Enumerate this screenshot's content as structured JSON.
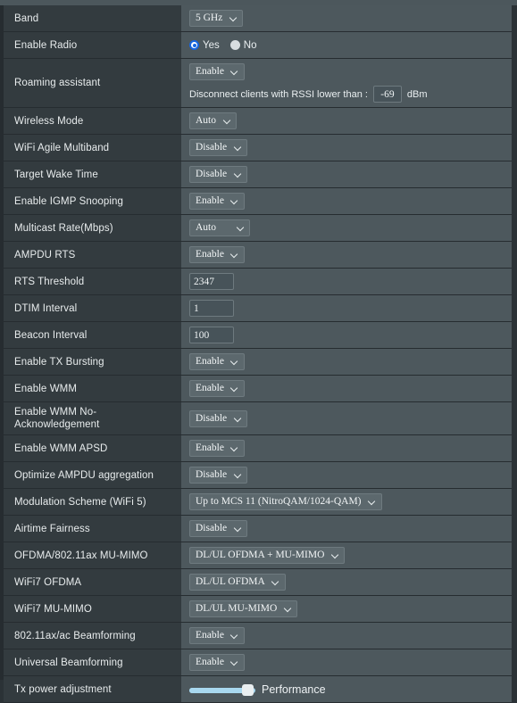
{
  "theme": {
    "panel_bg": "#4d585d",
    "label_bg": "#333b3f",
    "divider": "#262c30",
    "control_bg": "#5c686d",
    "input_bg": "#475359",
    "accent_radio": "#1565e0",
    "slider_track": "#a8d8ef"
  },
  "rows": [
    {
      "label": "Band",
      "control": "select",
      "value": "5 GHz"
    },
    {
      "label": "Enable Radio",
      "control": "radio",
      "options": [
        "Yes",
        "No"
      ],
      "selected": "Yes"
    },
    {
      "label": "Roaming assistant",
      "control": "select-with-note",
      "value": "Enable",
      "note_text": "Disconnect clients with RSSI lower than :",
      "note_value": "-69",
      "note_unit": "dBm"
    },
    {
      "label": "Wireless Mode",
      "control": "select",
      "value": "Auto"
    },
    {
      "label": "WiFi Agile Multiband",
      "control": "select",
      "value": "Disable"
    },
    {
      "label": "Target Wake Time",
      "control": "select",
      "value": "Disable"
    },
    {
      "label": "Enable IGMP Snooping",
      "control": "select",
      "value": "Enable"
    },
    {
      "label": "Multicast Rate(Mbps)",
      "control": "select-wide",
      "value": "Auto"
    },
    {
      "label": "AMPDU RTS",
      "control": "select",
      "value": "Enable"
    },
    {
      "label": "RTS Threshold",
      "control": "input",
      "value": "2347"
    },
    {
      "label": "DTIM Interval",
      "control": "input",
      "value": "1"
    },
    {
      "label": "Beacon Interval",
      "control": "input",
      "value": "100"
    },
    {
      "label": "Enable TX Bursting",
      "control": "select",
      "value": "Enable"
    },
    {
      "label": "Enable WMM",
      "control": "select",
      "value": "Enable"
    },
    {
      "label": "Enable WMM No-Acknowledgement",
      "control": "select",
      "value": "Disable"
    },
    {
      "label": "Enable WMM APSD",
      "control": "select",
      "value": "Enable"
    },
    {
      "label": "Optimize AMPDU aggregation",
      "control": "select",
      "value": "Disable"
    },
    {
      "label": "Modulation Scheme (WiFi 5)",
      "control": "select",
      "value": "Up to MCS 11 (NitroQAM/1024-QAM)"
    },
    {
      "label": "Airtime Fairness",
      "control": "select",
      "value": "Disable"
    },
    {
      "label": "OFDMA/802.11ax MU-MIMO",
      "control": "select",
      "value": "DL/UL OFDMA + MU-MIMO"
    },
    {
      "label": "WiFi7 OFDMA",
      "control": "select",
      "value": "DL/UL OFDMA"
    },
    {
      "label": "WiFi7 MU-MIMO",
      "control": "select",
      "value": "DL/UL MU-MIMO"
    },
    {
      "label": "802.11ax/ac Beamforming",
      "control": "select",
      "value": "Enable"
    },
    {
      "label": "Universal Beamforming",
      "control": "select",
      "value": "Enable"
    },
    {
      "label": "Tx power adjustment",
      "control": "slider",
      "value": "Performance",
      "percent": 84
    }
  ]
}
